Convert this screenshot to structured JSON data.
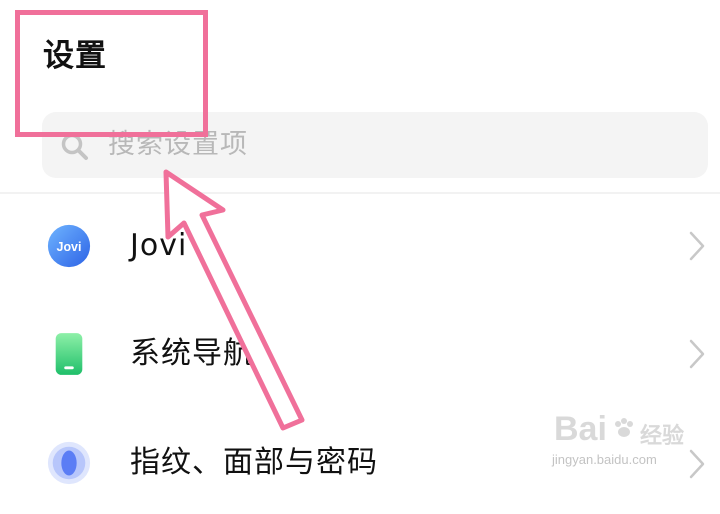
{
  "header": {
    "title": "设置"
  },
  "search": {
    "icon": "search-icon",
    "placeholder": "搜索设置项"
  },
  "settings_items": [
    {
      "label": "Jovi",
      "icon": "jovi-icon",
      "icon_text": "Jovi",
      "color": "#3d7cf0"
    },
    {
      "label": "系统导航",
      "icon": "phone-navigation-icon",
      "color": "#3ecf7a"
    },
    {
      "label": "指纹、面部与密码",
      "icon": "fingerprint-icon",
      "color": "#5b7df5"
    }
  ],
  "annotation": {
    "color": "#f0709a"
  },
  "watermark": {
    "brand": "Bai",
    "brand2": "经验",
    "url": "jingyan.baidu.com"
  }
}
